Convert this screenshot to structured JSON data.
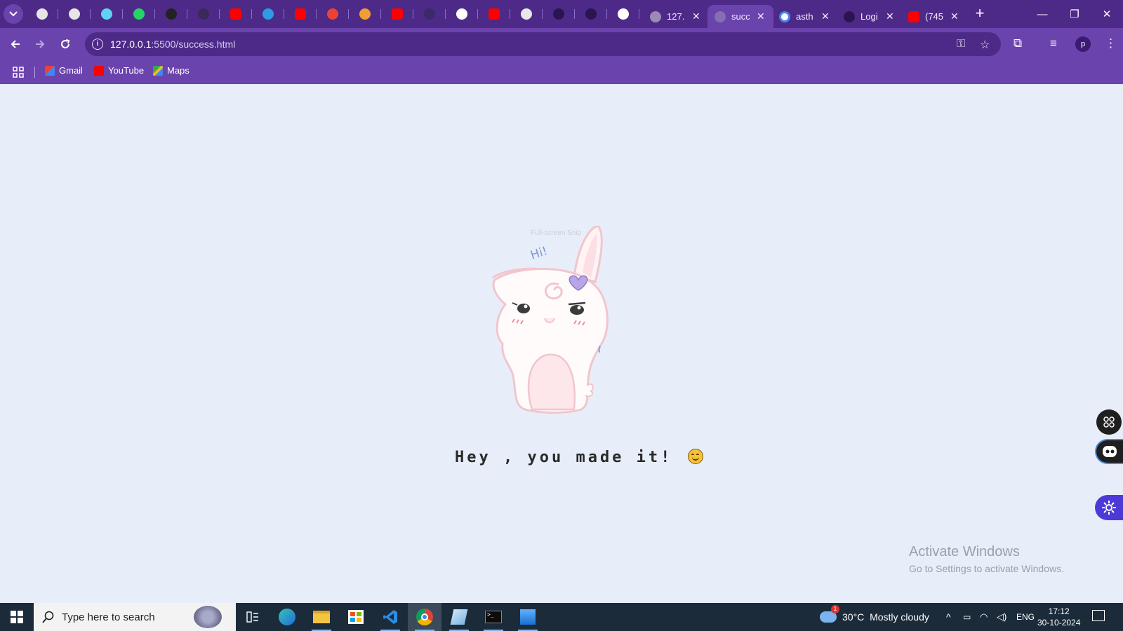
{
  "browser": {
    "tabs": [
      {
        "title": "127.",
        "favicon": "globe-icon"
      },
      {
        "title": "succ",
        "favicon": "loading-icon",
        "active": true
      },
      {
        "title": "asth",
        "favicon": "google-icon"
      },
      {
        "title": "Logi",
        "favicon": "github-icon"
      },
      {
        "title": "(745",
        "favicon": "youtube-icon"
      }
    ],
    "pinned_tabs": [
      "openai-icon",
      "openai-icon",
      "react-icon",
      "whatsapp-icon",
      "ai-icon",
      "triangle-icon",
      "youtube-icon",
      "app-icon",
      "youtube-icon",
      "gmail-icon",
      "gear-icon",
      "youtube-icon",
      "dark-icon",
      "discord-icon",
      "youtube-icon",
      "doc-icon",
      "github-icon",
      "github-icon",
      "scratch-icon"
    ],
    "address": {
      "host": "127.0.0.1",
      "path": ":5500/success.html"
    },
    "profile_initial": "p",
    "bookmarks": [
      {
        "label": "Gmail",
        "icon": "gmail-icon"
      },
      {
        "label": "YouTube",
        "icon": "youtube-icon"
      },
      {
        "label": "Maps",
        "icon": "maps-icon"
      }
    ]
  },
  "page": {
    "snip_label": "Full-screen Snip",
    "mascot_greeting": "Hi!",
    "message": "Hey , you made it!"
  },
  "watermark": {
    "title": "Activate Windows",
    "subtitle": "Go to Settings to activate Windows."
  },
  "taskbar": {
    "search_placeholder": "Type here to search",
    "weather": {
      "temp": "30°C",
      "condition": "Mostly cloudy",
      "badge": "1"
    },
    "language": "ENG",
    "time": "17:12",
    "date": "30-10-2024"
  },
  "colors": {
    "frame": "#4e2a88",
    "toolbar": "#6b43ad",
    "page_bg": "#e8eef9",
    "taskbar": "#1c2b3a"
  }
}
